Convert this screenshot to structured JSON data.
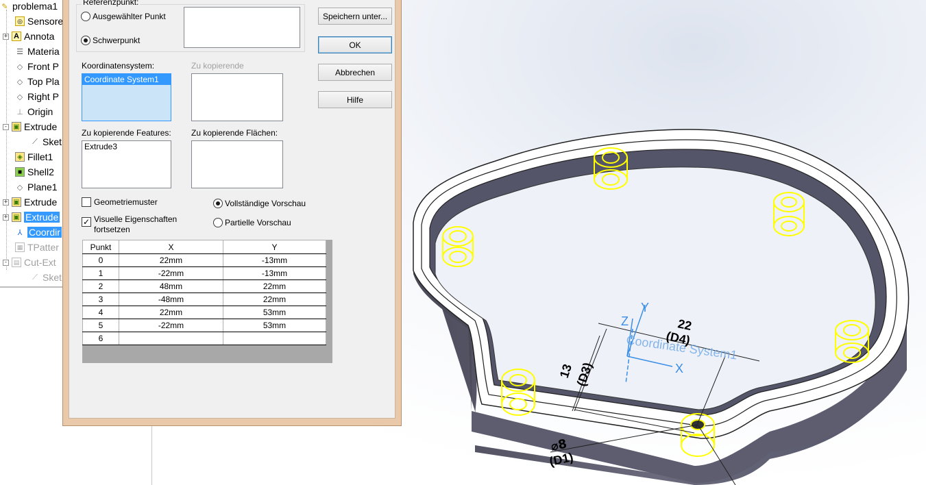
{
  "tree": {
    "items": [
      {
        "label": "problema1",
        "icon": "part-icon",
        "expander": ""
      },
      {
        "label": "Sensore",
        "icon": "sensor-icon",
        "expander": ""
      },
      {
        "label": "Annota",
        "icon": "annotation-icon",
        "expander": "+"
      },
      {
        "label": "Materia",
        "icon": "material-icon",
        "expander": ""
      },
      {
        "label": "Front P",
        "icon": "plane-icon",
        "expander": ""
      },
      {
        "label": "Top Pla",
        "icon": "plane-icon",
        "expander": ""
      },
      {
        "label": "Right P",
        "icon": "plane-icon",
        "expander": ""
      },
      {
        "label": "Origin",
        "icon": "origin-icon",
        "expander": ""
      },
      {
        "label": "Extrude",
        "icon": "extrude-icon",
        "expander": "-"
      },
      {
        "label": "Sket",
        "icon": "sketch-icon",
        "expander": ""
      },
      {
        "label": "Fillet1",
        "icon": "fillet-icon",
        "expander": ""
      },
      {
        "label": "Shell2",
        "icon": "shell-icon",
        "expander": ""
      },
      {
        "label": "Plane1",
        "icon": "plane-icon",
        "expander": ""
      },
      {
        "label": "Extrude",
        "icon": "extrude-icon",
        "expander": "+"
      },
      {
        "label": "Extrude",
        "icon": "extrude-icon",
        "expander": "+"
      },
      {
        "label": "Coordir",
        "icon": "coordinate-system-icon",
        "expander": ""
      },
      {
        "label": "TPatter",
        "icon": "table-pattern-icon",
        "expander": ""
      },
      {
        "label": "Cut-Ext",
        "icon": "cut-extrude-icon",
        "expander": "-"
      },
      {
        "label": "Sket",
        "icon": "sketch-icon",
        "expander": ""
      }
    ]
  },
  "dialog": {
    "reference_group_title": "Referenzpunkt:",
    "radio_selected_point": "Ausgewählter Punkt",
    "radio_centroid": "Schwerpunkt",
    "coord_system_label": "Koordinatensystem:",
    "coord_system_item": "Coordinate System1",
    "to_copy_label": "Zu kopierende",
    "features_label": "Zu kopierende Features:",
    "features_item": "Extrude3",
    "faces_label": "Zu kopierende Flächen:",
    "geometry_pattern_label": "Geometriemuster",
    "visual_props_label_1": "Visuelle Eigenschaften",
    "visual_props_label_2": "fortsetzen",
    "full_preview_label": "Vollständige Vorschau",
    "partial_preview_label": "Partielle Vorschau",
    "save_as_button": "Speichern unter...",
    "ok_button": "OK",
    "cancel_button": "Abbrechen",
    "help_button": "Hilfe",
    "check_mark": "✓",
    "table": {
      "headers": [
        "Punkt",
        "X",
        "Y"
      ],
      "rows": [
        [
          "0",
          "22mm",
          "-13mm"
        ],
        [
          "1",
          "-22mm",
          "-13mm"
        ],
        [
          "2",
          "48mm",
          "22mm"
        ],
        [
          "3",
          "-48mm",
          "22mm"
        ],
        [
          "4",
          "22mm",
          "53mm"
        ],
        [
          "5",
          "-22mm",
          "53mm"
        ],
        [
          "6",
          "",
          ""
        ]
      ]
    }
  },
  "viewport": {
    "dim_22": "22",
    "dim_d4": "(D4)",
    "dim_13": "13",
    "dim_d3": "(D3)",
    "dim_phi8": "⌀8",
    "dim_d1": "(D1)",
    "coord_system_name": "Coordinate System1",
    "axis_x": "X",
    "axis_y": "Y",
    "axis_z": "Z",
    "colors": {
      "body": "#5c5c6e",
      "rim": "#ffffff",
      "feature": "#ffff00",
      "axis": "#3a8ee6"
    }
  }
}
